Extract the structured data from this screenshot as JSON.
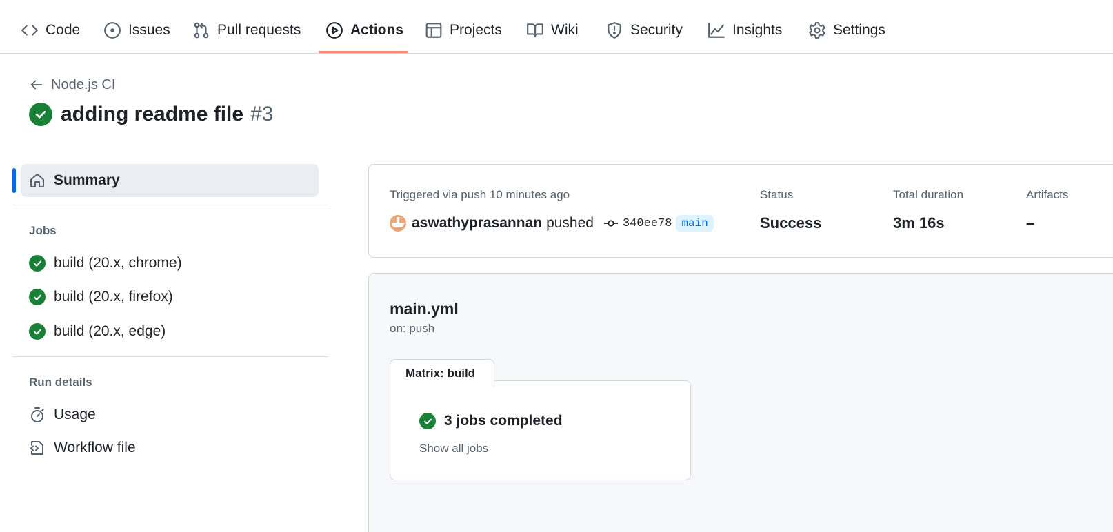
{
  "nav": {
    "tabs": [
      {
        "label": "Code",
        "icon": "code-icon"
      },
      {
        "label": "Issues",
        "icon": "issue-icon"
      },
      {
        "label": "Pull requests",
        "icon": "pull-request-icon"
      },
      {
        "label": "Actions",
        "icon": "play-icon",
        "active": true
      },
      {
        "label": "Projects",
        "icon": "table-icon"
      },
      {
        "label": "Wiki",
        "icon": "book-icon"
      },
      {
        "label": "Security",
        "icon": "shield-icon"
      },
      {
        "label": "Insights",
        "icon": "graph-icon"
      },
      {
        "label": "Settings",
        "icon": "gear-icon"
      }
    ]
  },
  "header": {
    "workflow_name": "Node.js CI",
    "run_title": "adding readme file",
    "run_number": "#3"
  },
  "sidebar": {
    "summary_label": "Summary",
    "jobs_heading": "Jobs",
    "jobs": [
      {
        "label": "build (20.x, chrome)",
        "status": "success"
      },
      {
        "label": "build (20.x, firefox)",
        "status": "success"
      },
      {
        "label": "build (20.x, edge)",
        "status": "success"
      }
    ],
    "run_details_heading": "Run details",
    "run_details": [
      {
        "label": "Usage",
        "icon": "stopwatch-icon"
      },
      {
        "label": "Workflow file",
        "icon": "file-code-icon"
      }
    ]
  },
  "summary": {
    "trigger_text": "Triggered via push 10 minutes ago",
    "actor": "aswathyprasannan",
    "action": "pushed",
    "commit_sha": "340ee78",
    "branch": "main",
    "status_label": "Status",
    "status_value": "Success",
    "duration_label": "Total duration",
    "duration_value": "3m 16s",
    "artifacts_label": "Artifacts",
    "artifacts_value": "–"
  },
  "workflow": {
    "file_name": "main.yml",
    "trigger": "on: push",
    "matrix_label": "Matrix: build",
    "jobs_completed": "3 jobs completed",
    "show_all": "Show all jobs"
  },
  "colors": {
    "success": "#1a7f37",
    "accent_underline": "#fd8c73",
    "link_blue": "#0969da",
    "muted": "#59636e"
  }
}
